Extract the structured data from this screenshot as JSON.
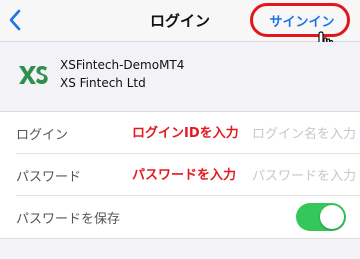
{
  "nav": {
    "title": "ログイン",
    "back_icon": "chevron-left-icon",
    "signin_label": "サインイン"
  },
  "account": {
    "logo_icon": "xs-logo-icon",
    "server": "XSFintech-DemoMT4",
    "company": "XS Fintech Ltd"
  },
  "form": {
    "login_label": "ログイン",
    "login_placeholder": "ログイン名を入力",
    "login_annotation": "ログインIDを入力",
    "password_label": "パスワード",
    "password_placeholder": "パスワードを入力",
    "password_annotation": "パスワードを入力",
    "save_password_label": "パスワードを保存",
    "save_password_enabled": true
  },
  "colors": {
    "accent": "#1a73e8",
    "highlight": "#e3161b",
    "toggle_on": "#34c759",
    "logo_green": "#2f8f4e"
  }
}
